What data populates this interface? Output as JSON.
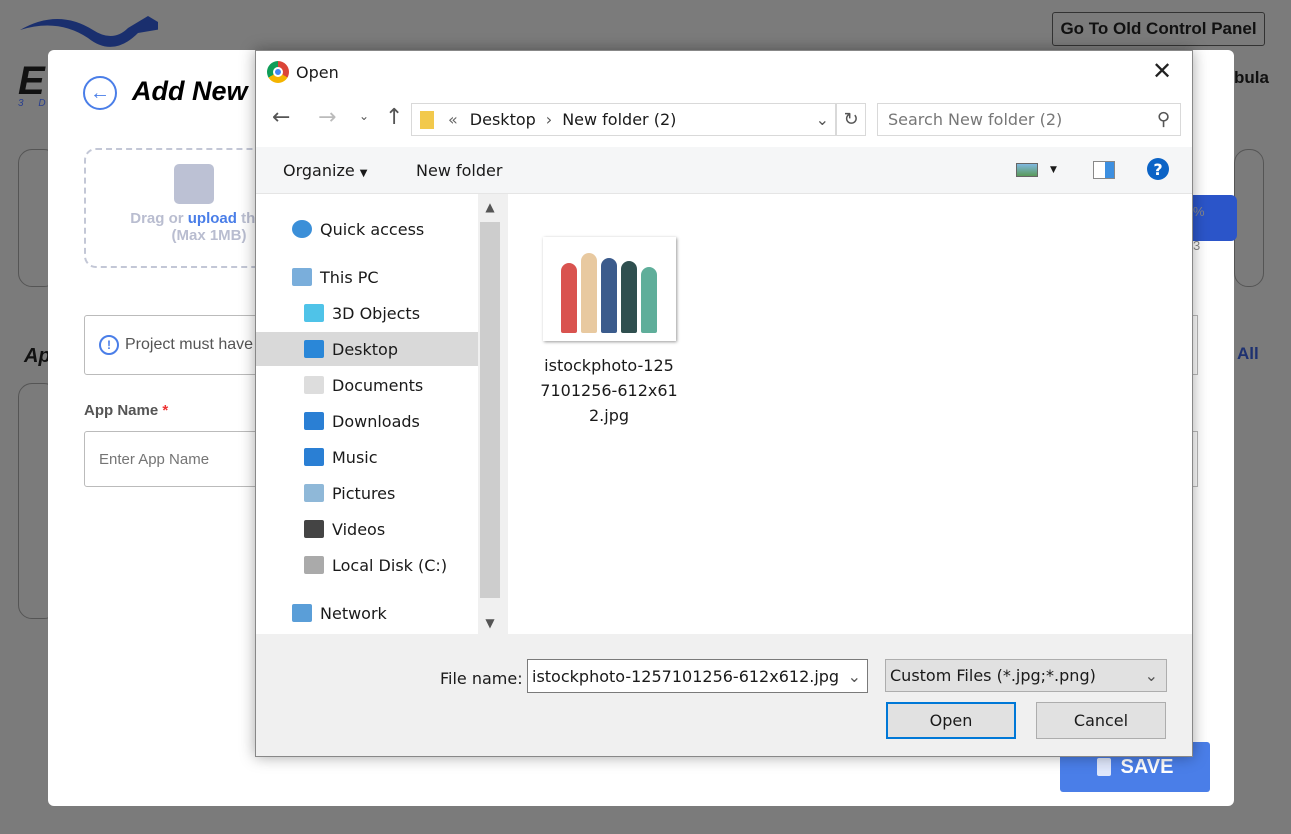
{
  "background": {
    "logo_sub": "3 D",
    "top_button": "Go To Old Control Panel",
    "user_fragment": "bula",
    "section_fragment": "Ap",
    "see_all_fragment": "All",
    "stat_fragments": [
      "%",
      "3"
    ]
  },
  "modal": {
    "title": "Add New",
    "upload_text_prefix": "Drag or ",
    "upload_link": "upload",
    "upload_text_suffix": " thum",
    "upload_max": "(Max 1MB)",
    "notice": "Project must have",
    "app_name_label": "App Name",
    "required_mark": "*",
    "app_name_placeholder": "Enter App Name",
    "save_label": "SAVE"
  },
  "dialog": {
    "title": "Open",
    "breadcrumb": [
      "Desktop",
      "New folder (2)"
    ],
    "search_placeholder": "Search New folder (2)",
    "toolbar": {
      "organize": "Organize",
      "new_folder": "New folder"
    },
    "nav": [
      {
        "label": "Quick access",
        "icon": "star-icon",
        "level": 0
      },
      {
        "label": "This PC",
        "icon": "computer-icon",
        "level": 0
      },
      {
        "label": "3D Objects",
        "icon": "cube-icon",
        "level": 1
      },
      {
        "label": "Desktop",
        "icon": "desktop-icon",
        "level": 1,
        "selected": true
      },
      {
        "label": "Documents",
        "icon": "document-icon",
        "level": 1
      },
      {
        "label": "Downloads",
        "icon": "download-icon",
        "level": 1
      },
      {
        "label": "Music",
        "icon": "music-icon",
        "level": 1
      },
      {
        "label": "Pictures",
        "icon": "pictures-icon",
        "level": 1
      },
      {
        "label": "Videos",
        "icon": "videos-icon",
        "level": 1
      },
      {
        "label": "Local Disk (C:)",
        "icon": "disk-icon",
        "level": 1
      },
      {
        "label": "Network",
        "icon": "network-icon",
        "level": 0
      }
    ],
    "files": [
      {
        "name_lines": [
          "istockphoto-125",
          "7101256-612x61",
          "2.jpg"
        ]
      }
    ],
    "file_name_label": "File name:",
    "file_name_value": "istockphoto-1257101256-612x612.jpg",
    "file_type": "Custom Files (*.jpg;*.png)",
    "open_label": "Open",
    "cancel_label": "Cancel"
  },
  "colors": {
    "accent": "#4a7ee8",
    "selected": "#cce8ff",
    "overlay": "#7b7b7b"
  }
}
